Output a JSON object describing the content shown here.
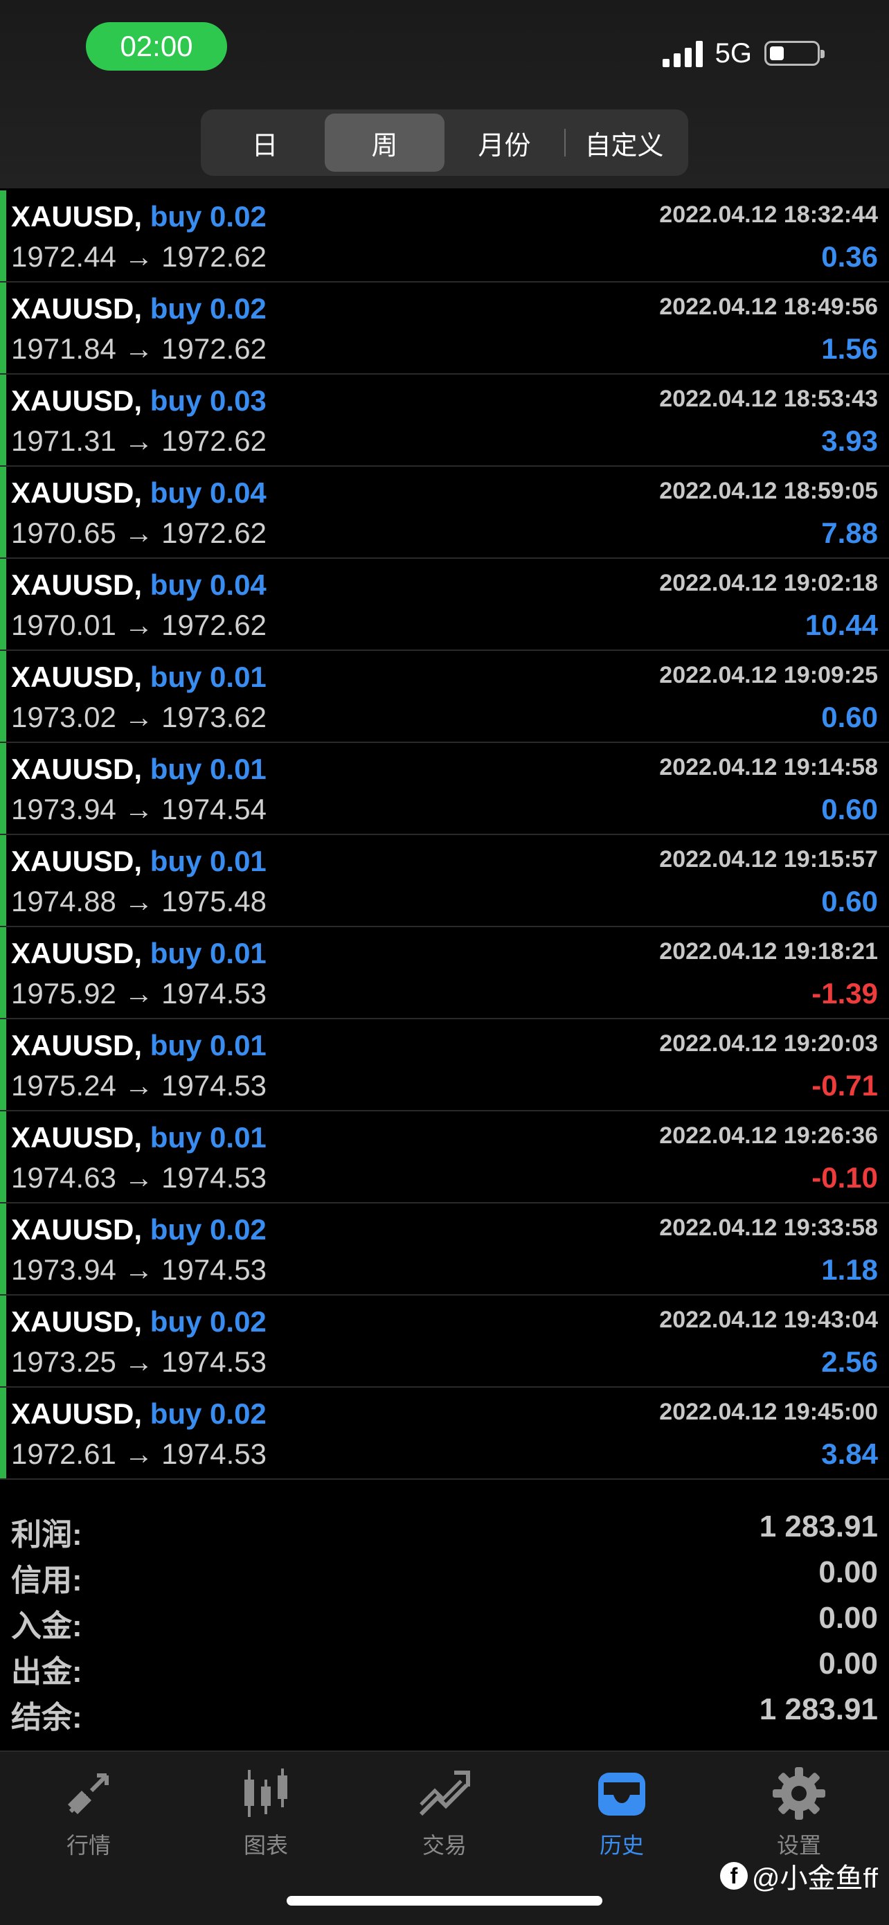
{
  "status_bar": {
    "time": "02:00",
    "network": "5G"
  },
  "segments": [
    {
      "label": "日",
      "active": false
    },
    {
      "label": "周",
      "active": true
    },
    {
      "label": "月份",
      "active": false
    },
    {
      "label": "自定义",
      "active": false
    }
  ],
  "trades": [
    {
      "symbol": "XAUUSD,",
      "side": "buy 0.02",
      "datetime": "2022.04.12 18:32:44",
      "prices": "1972.44 → 1972.62",
      "profit": "0.36",
      "negative": false
    },
    {
      "symbol": "XAUUSD,",
      "side": "buy 0.02",
      "datetime": "2022.04.12 18:49:56",
      "prices": "1971.84 → 1972.62",
      "profit": "1.56",
      "negative": false
    },
    {
      "symbol": "XAUUSD,",
      "side": "buy 0.03",
      "datetime": "2022.04.12 18:53:43",
      "prices": "1971.31 → 1972.62",
      "profit": "3.93",
      "negative": false
    },
    {
      "symbol": "XAUUSD,",
      "side": "buy 0.04",
      "datetime": "2022.04.12 18:59:05",
      "prices": "1970.65 → 1972.62",
      "profit": "7.88",
      "negative": false
    },
    {
      "symbol": "XAUUSD,",
      "side": "buy 0.04",
      "datetime": "2022.04.12 19:02:18",
      "prices": "1970.01 → 1972.62",
      "profit": "10.44",
      "negative": false
    },
    {
      "symbol": "XAUUSD,",
      "side": "buy 0.01",
      "datetime": "2022.04.12 19:09:25",
      "prices": "1973.02 → 1973.62",
      "profit": "0.60",
      "negative": false
    },
    {
      "symbol": "XAUUSD,",
      "side": "buy 0.01",
      "datetime": "2022.04.12 19:14:58",
      "prices": "1973.94 → 1974.54",
      "profit": "0.60",
      "negative": false
    },
    {
      "symbol": "XAUUSD,",
      "side": "buy 0.01",
      "datetime": "2022.04.12 19:15:57",
      "prices": "1974.88 → 1975.48",
      "profit": "0.60",
      "negative": false
    },
    {
      "symbol": "XAUUSD,",
      "side": "buy 0.01",
      "datetime": "2022.04.12 19:18:21",
      "prices": "1975.92 → 1974.53",
      "profit": "-1.39",
      "negative": true
    },
    {
      "symbol": "XAUUSD,",
      "side": "buy 0.01",
      "datetime": "2022.04.12 19:20:03",
      "prices": "1975.24 → 1974.53",
      "profit": "-0.71",
      "negative": true
    },
    {
      "symbol": "XAUUSD,",
      "side": "buy 0.01",
      "datetime": "2022.04.12 19:26:36",
      "prices": "1974.63 → 1974.53",
      "profit": "-0.10",
      "negative": true
    },
    {
      "symbol": "XAUUSD,",
      "side": "buy 0.02",
      "datetime": "2022.04.12 19:33:58",
      "prices": "1973.94 → 1974.53",
      "profit": "1.18",
      "negative": false
    },
    {
      "symbol": "XAUUSD,",
      "side": "buy 0.02",
      "datetime": "2022.04.12 19:43:04",
      "prices": "1973.25 → 1974.53",
      "profit": "2.56",
      "negative": false
    },
    {
      "symbol": "XAUUSD,",
      "side": "buy 0.02",
      "datetime": "2022.04.12 19:45:00",
      "prices": "1972.61 → 1974.53",
      "profit": "3.84",
      "negative": false
    }
  ],
  "summary": [
    {
      "label": "利润:",
      "value": "1 283.91"
    },
    {
      "label": "信用:",
      "value": "0.00"
    },
    {
      "label": "入金:",
      "value": "0.00"
    },
    {
      "label": "出金:",
      "value": "0.00"
    },
    {
      "label": "结余:",
      "value": "1 283.91"
    }
  ],
  "tabs": [
    {
      "label": "行情",
      "icon": "quotes-arrows-icon",
      "active": false
    },
    {
      "label": "图表",
      "icon": "candlestick-chart-icon",
      "active": false
    },
    {
      "label": "交易",
      "icon": "trade-trend-icon",
      "active": false
    },
    {
      "label": "历史",
      "icon": "history-inbox-icon",
      "active": true
    },
    {
      "label": "设置",
      "icon": "gear-icon",
      "active": false
    }
  ],
  "watermark": {
    "logo": "f",
    "text": "@小金鱼ff"
  },
  "colors": {
    "accent_blue": "#3a8df0",
    "loss_red": "#ee3b3b",
    "buy_bar_green": "#2db548",
    "time_pill_green": "#2fc84f"
  }
}
